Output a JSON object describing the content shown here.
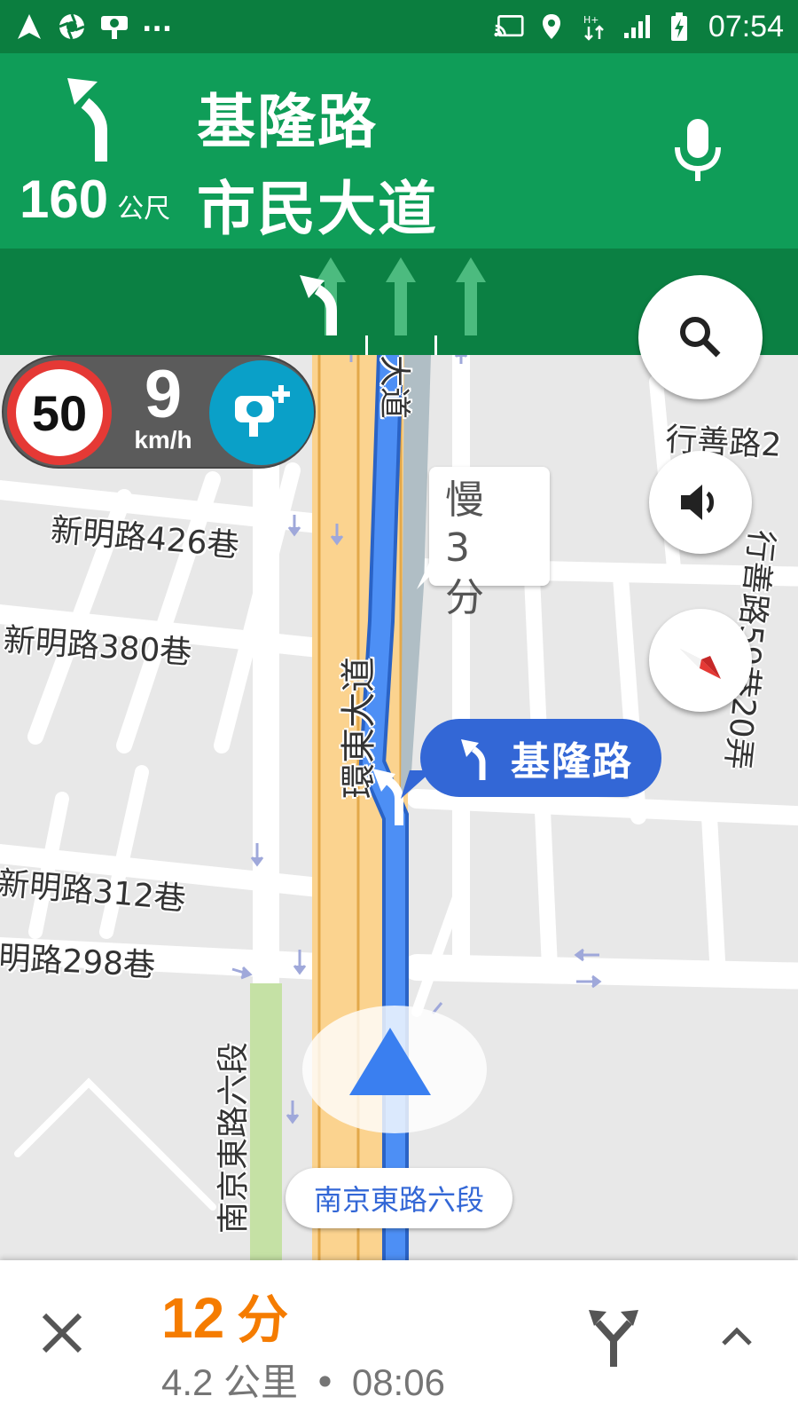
{
  "status_bar": {
    "left_icons": [
      "navigation-icon",
      "aperture-icon",
      "speed-camera-icon"
    ],
    "more": "...",
    "right_icons": [
      "cast-icon",
      "location-pin-icon",
      "data-arrows-icon",
      "signal-icon",
      "battery-charging-icon"
    ],
    "time": "07:54"
  },
  "nav_header": {
    "turn_icon": "turn-slight-left-icon",
    "distance_value": "160",
    "distance_unit": "公尺",
    "street_primary": "基隆路",
    "street_secondary": "市民大道",
    "mic_icon": "microphone-icon"
  },
  "lanes": [
    "turn-left",
    "straight",
    "straight",
    "straight"
  ],
  "speed": {
    "limit": "50",
    "current": "9",
    "unit": "km/h",
    "camera_button_icon": "add-speed-camera-icon"
  },
  "map": {
    "labels": {
      "xinming_426": "新明路426巷",
      "xinming_380": "新明路380巷",
      "xinming_312": "新明路312巷",
      "ming_298": "明路298巷",
      "huandong": "環東大道",
      "dadao": "大道",
      "xingshan_2": "行善路2",
      "xingshan_59": "行善路59巷20弄",
      "nanjing_vertical": "南京東路六段"
    },
    "traffic_callout": {
      "line1": "慢",
      "line2": "3 分"
    },
    "turn_callout": {
      "icon": "turn-slight-left-icon",
      "text": "基隆路"
    },
    "current_road": "南京東路六段",
    "buttons": {
      "search": "search-icon",
      "sound": "volume-icon",
      "compass": "compass-icon"
    }
  },
  "bottom": {
    "close_icon": "close-icon",
    "eta_minutes": "12",
    "eta_unit": "分",
    "distance": "4.2 公里",
    "separator": "•",
    "arrival_time": "08:06",
    "route_icon": "alternate-routes-icon",
    "expand_icon": "chevron-up-icon"
  },
  "colors": {
    "header_green": "#0f9d58",
    "status_green": "#0b7e3f",
    "route_blue": "#4285f4",
    "eta_orange": "#f57c00",
    "highway_orange": "#fbd38f"
  }
}
